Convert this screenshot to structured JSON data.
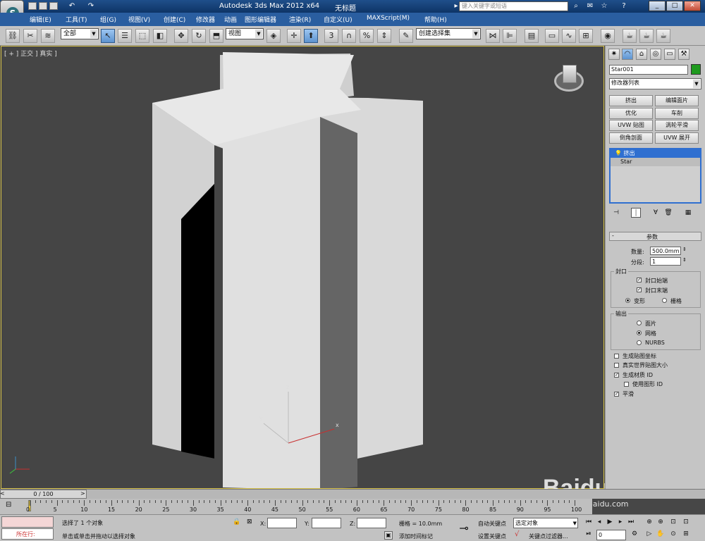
{
  "title": {
    "app": "Autodesk 3ds Max  2012 x64",
    "document": "无标题",
    "search_placeholder": "键入关键字或短语"
  },
  "menu": [
    "编辑(E)",
    "工具(T)",
    "组(G)",
    "视图(V)",
    "创建(C)",
    "修改器",
    "动画",
    "图形编辑器",
    "渲染(R)",
    "自定义(U)",
    "MAXScript(M)",
    "帮助(H)"
  ],
  "toolbar": {
    "selection_filter": "全部",
    "ref_coord": "视图",
    "named_selection": "创建选择集",
    "snap_labels": [
      "3",
      "%"
    ]
  },
  "viewport": {
    "label": "[ + ] 正交 ] 真实 ]",
    "gizmo_axes": [
      "x",
      "y",
      "z"
    ]
  },
  "command_panel": {
    "object_name": "Star001",
    "object_color": "#1e9a1e",
    "modifier_list": "修改器列表",
    "modifier_buttons": [
      "挤出",
      "编辑面片",
      "优化",
      "车削",
      "UVW 贴图",
      "涡轮平滑",
      "倒角剖面",
      "UVW 展开"
    ],
    "stack": [
      "挤出",
      "Star"
    ],
    "rollout_title": "参数",
    "amount_label": "数量:",
    "amount_value": "500.0mm",
    "segments_label": "分段:",
    "segments_value": "1",
    "capping_title": "封口",
    "cap_start": "封口始端",
    "cap_end": "封口末端",
    "morph": "变形",
    "grid": "栅格",
    "output_title": "输出",
    "out_patch": "面片",
    "out_mesh": "网格",
    "out_nurbs": "NURBS",
    "gen_mapping": "生成贴图坐标",
    "real_world": "真实世界贴图大小",
    "gen_matid": "生成材质 ID",
    "use_shape_id": "使用图形 ID",
    "smooth": "平滑"
  },
  "timeline": {
    "frame_display": "0 / 100",
    "ticks": [
      "0",
      "5",
      "10",
      "15",
      "20",
      "25",
      "30",
      "35",
      "40",
      "45",
      "50",
      "55",
      "60",
      "65",
      "70",
      "75",
      "80",
      "85",
      "90",
      "95",
      "100"
    ]
  },
  "status": {
    "maxscript_label": "所在行:",
    "selection_msg": "选择了 1 个对象",
    "prompt_msg": "单击或单击并拖动以选择对象",
    "x_label": "X:",
    "y_label": "Y:",
    "z_label": "Z:",
    "grid": "栅格 = 10.0mm",
    "add_time_tag": "添加时间标记",
    "auto_key": "自动关键点",
    "set_key": "设置关键点",
    "selected": "选定对象",
    "key_filters": "关键点过滤器...",
    "frame_value": "0"
  },
  "watermark": {
    "brand": "Baidu经验",
    "url": "jingyan.baidu.com"
  }
}
